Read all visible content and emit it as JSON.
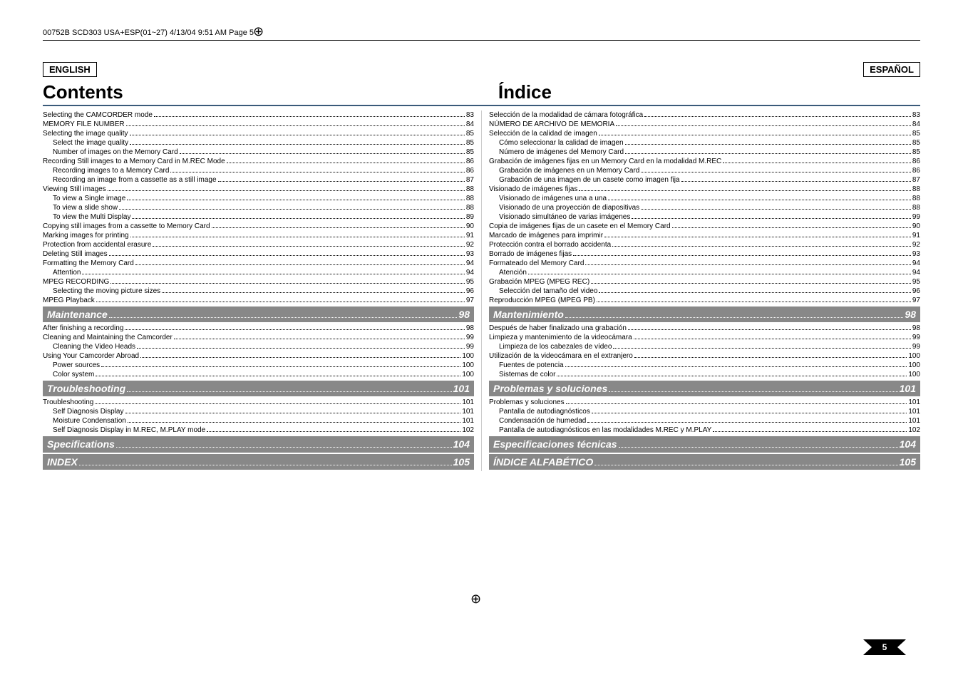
{
  "header": "00752B SCD303 USA+ESP(01~27)  4/13/04 9:51 AM  Page 5",
  "left_lang": "ENGLISH",
  "right_lang": "ESPAÑOL",
  "left_title": "Contents",
  "right_title": "Índice",
  "page_number": "5",
  "left_toc": [
    {
      "t": "Selecting the CAMCORDER mode",
      "p": "83",
      "i": 0
    },
    {
      "t": "MEMORY FILE NUMBER",
      "p": "84",
      "i": 0
    },
    {
      "t": "Selecting the image quality",
      "p": "85",
      "i": 0
    },
    {
      "t": "Select the image quality",
      "p": "85",
      "i": 1
    },
    {
      "t": "Number of images on the Memory Card",
      "p": "85",
      "i": 1
    },
    {
      "t": "Recording Still images to a Memory Card in M.REC Mode",
      "p": "86",
      "i": 0
    },
    {
      "t": "Recording images to a Memory Card",
      "p": "86",
      "i": 1
    },
    {
      "t": "Recording an image from a cassette as a still image",
      "p": "87",
      "i": 1
    },
    {
      "t": "Viewing Still images",
      "p": "88",
      "i": 0
    },
    {
      "t": "To view a Single image",
      "p": "88",
      "i": 1
    },
    {
      "t": "To view a slide show",
      "p": "88",
      "i": 1
    },
    {
      "t": "To view the Multi Display",
      "p": "89",
      "i": 1
    },
    {
      "t": "Copying still images from a cassette to Memory Card",
      "p": "90",
      "i": 0
    },
    {
      "t": "Marking images for printing",
      "p": "91",
      "i": 0
    },
    {
      "t": "Protection from accidental erasure",
      "p": "92",
      "i": 0
    },
    {
      "t": "Deleting Still images",
      "p": "93",
      "i": 0
    },
    {
      "t": "Formatting the Memory Card",
      "p": "94",
      "i": 0
    },
    {
      "t": "Attention",
      "p": "94",
      "i": 1
    },
    {
      "t": "MPEG RECORDING",
      "p": "95",
      "i": 0
    },
    {
      "t": "Selecting the moving picture sizes",
      "p": "96",
      "i": 1
    },
    {
      "t": "MPEG Playback",
      "p": "97",
      "i": 0
    }
  ],
  "left_sec_maint": {
    "t": "Maintenance",
    "p": "98"
  },
  "left_maint": [
    {
      "t": "After finishing a recording",
      "p": "98",
      "i": 0
    },
    {
      "t": "Cleaning and Maintaining the Camcorder",
      "p": "99",
      "i": 0
    },
    {
      "t": "Cleaning the Video Heads",
      "p": "99",
      "i": 1
    },
    {
      "t": "Using Your Camcorder Abroad",
      "p": "100",
      "i": 0
    },
    {
      "t": "Power sources",
      "p": "100",
      "i": 1
    },
    {
      "t": "Color system",
      "p": "100",
      "i": 1
    }
  ],
  "left_sec_trouble": {
    "t": "Troubleshooting",
    "p": "101"
  },
  "left_trouble": [
    {
      "t": "Troubleshooting",
      "p": "101",
      "i": 0
    },
    {
      "t": "Self Diagnosis Display",
      "p": "101",
      "i": 1
    },
    {
      "t": "Moisture Condensation",
      "p": "101",
      "i": 1
    },
    {
      "t": "Self Diagnosis Display in M.REC, M.PLAY mode",
      "p": "102",
      "i": 1
    }
  ],
  "left_sec_spec": {
    "t": "Specifications",
    "p": "104"
  },
  "left_sec_index": {
    "t": "INDEX",
    "p": "105"
  },
  "right_toc": [
    {
      "t": "Selección de la modalidad de cámara fotográfica",
      "p": "83",
      "i": 0
    },
    {
      "t": "NÚMERO DE ARCHIVO DE MEMORIA",
      "p": "84",
      "i": 0
    },
    {
      "t": "Selección de la calidad de imagen",
      "p": "85",
      "i": 0
    },
    {
      "t": "Cómo seleccionar la calidad de imagen",
      "p": "85",
      "i": 1
    },
    {
      "t": "Número de imágenes del Memory Card",
      "p": "85",
      "i": 1
    },
    {
      "t": "Grabación de imágenes fijas en un Memory Card en la modalidad M.REC",
      "p": "86",
      "i": 0
    },
    {
      "t": "Grabación de imágenes en un Memory Card",
      "p": "86",
      "i": 1
    },
    {
      "t": "Grabación de una imagen de un casete como imagen fija",
      "p": "87",
      "i": 1
    },
    {
      "t": "Visionado de imágenes fijas",
      "p": "88",
      "i": 0
    },
    {
      "t": "Visionado de imágenes una a una",
      "p": "88",
      "i": 1
    },
    {
      "t": "Visionado de una proyección de diapositivas",
      "p": "88",
      "i": 1
    },
    {
      "t": "Visionado simultáneo de varias imágenes",
      "p": "99",
      "i": 1
    },
    {
      "t": "Copia de imágenes fijas de un casete en el Memory Card",
      "p": "90",
      "i": 0
    },
    {
      "t": "Marcado de imágenes para imprimir",
      "p": "91",
      "i": 0
    },
    {
      "t": "Protección contra el borrado accidenta",
      "p": "92",
      "i": 0
    },
    {
      "t": "Borrado de imágenes fijas",
      "p": "93",
      "i": 0
    },
    {
      "t": "Formateado del Memory Card",
      "p": "94",
      "i": 0
    },
    {
      "t": "Atención",
      "p": "94",
      "i": 1
    },
    {
      "t": "Grabación MPEG (MPEG REC)",
      "p": "95",
      "i": 0
    },
    {
      "t": "Selección del tamaño del video",
      "p": "96",
      "i": 1
    },
    {
      "t": "Reproducción MPEG (MPEG PB)",
      "p": "97",
      "i": 0
    }
  ],
  "right_sec_maint": {
    "t": "Mantenimiento",
    "p": "98"
  },
  "right_maint": [
    {
      "t": "Después de haber finalizado una grabación",
      "p": "98",
      "i": 0
    },
    {
      "t": "Limpieza y mantenimiento de la videocámara",
      "p": "99",
      "i": 0
    },
    {
      "t": "Limpieza de los cabezales de vídeo",
      "p": "99",
      "i": 1
    },
    {
      "t": "Utilización de la videocámara en el extranjero",
      "p": "100",
      "i": 0
    },
    {
      "t": "Fuentes de potencia",
      "p": "100",
      "i": 1
    },
    {
      "t": "Sistemas de color",
      "p": "100",
      "i": 1
    }
  ],
  "right_sec_trouble": {
    "t": "Problemas y soluciones",
    "p": "101"
  },
  "right_trouble": [
    {
      "t": "Problemas y soluciones",
      "p": "101",
      "i": 0
    },
    {
      "t": "Pantalla de autodiagnósticos",
      "p": "101",
      "i": 1
    },
    {
      "t": "Condensación de humedad",
      "p": "101",
      "i": 1
    },
    {
      "t": "Pantalla de autodiagnósticos en las modalidades M.REC y M.PLAY",
      "p": "102",
      "i": 1
    }
  ],
  "right_sec_spec": {
    "t": "Especificaciones técnicas",
    "p": "104"
  },
  "right_sec_index": {
    "t": "ÍNDICE ALFABÉTICO",
    "p": "105"
  }
}
